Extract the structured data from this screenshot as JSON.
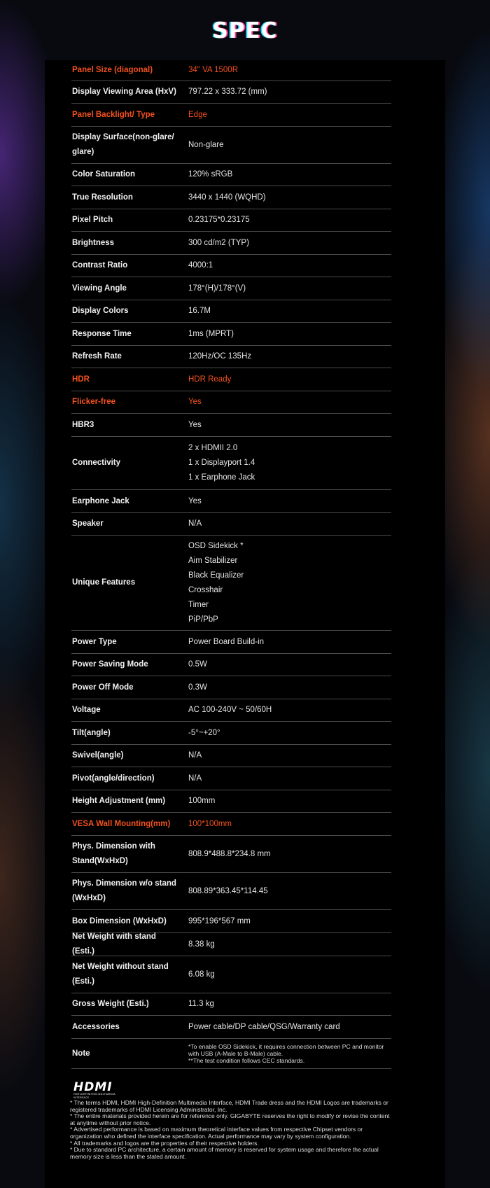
{
  "header": {
    "title": "SPEC"
  },
  "specs": [
    {
      "label": "Panel Size (diagonal)",
      "value": "34\" VA 1500R",
      "highlight": true
    },
    {
      "label": "Display Viewing Area (HxV)",
      "value": "797.22 x 333.72 (mm)"
    },
    {
      "label": "Panel Backlight/ Type",
      "value": "Edge",
      "highlight": true
    },
    {
      "label": "Display Surface(non-glare/ glare)",
      "value": "Non-glare"
    },
    {
      "label": "Color Saturation",
      "value": "120% sRGB"
    },
    {
      "label": "True Resolution",
      "value": "3440 x 1440 (WQHD)"
    },
    {
      "label": "Pixel Pitch",
      "value": "0.23175*0.23175"
    },
    {
      "label": "Brightness",
      "value": "300 cd/m2 (TYP)"
    },
    {
      "label": "Contrast Ratio",
      "value": "4000:1"
    },
    {
      "label": "Viewing Angle",
      "value": "178°(H)/178°(V)"
    },
    {
      "label": "Display Colors",
      "value": "16.7M"
    },
    {
      "label": "Response Time",
      "value": "1ms (MPRT)"
    },
    {
      "label": "Refresh Rate",
      "value": "120Hz/OC 135Hz"
    },
    {
      "label": "HDR",
      "value": "HDR Ready",
      "highlight": true
    },
    {
      "label": "Flicker-free",
      "value": "Yes",
      "highlight": true
    },
    {
      "label": "HBR3",
      "value": "Yes"
    },
    {
      "label": "Connectivity",
      "values": [
        "2 x HDMII 2.0",
        "1 x Displayport 1.4",
        "1 x Earphone Jack"
      ]
    },
    {
      "label": "Earphone Jack",
      "value": "Yes"
    },
    {
      "label": "Speaker",
      "value": "N/A"
    },
    {
      "label": "Unique Features",
      "values": [
        "OSD Sidekick *",
        "Aim Stabilizer",
        "Black Equalizer",
        "Crosshair",
        "Timer",
        "PiP/PbP"
      ]
    },
    {
      "label": "Power Type",
      "value": "Power Board Build-in"
    },
    {
      "label": "Power Saving Mode",
      "value": "0.5W"
    },
    {
      "label": "Power Off Mode",
      "value": "0.3W"
    },
    {
      "label": "Voltage",
      "value": "AC 100-240V ~ 50/60H"
    },
    {
      "label": "Tilt(angle)",
      "value": "-5°~+20°"
    },
    {
      "label": "Swivel(angle)",
      "value": "N/A"
    },
    {
      "label": "Pivot(angle/direction)",
      "value": "N/A"
    },
    {
      "label": "Height Adjustment (mm)",
      "value": "100mm"
    },
    {
      "label": "VESA Wall Mounting(mm)",
      "value": "100*100mm",
      "highlight": true
    },
    {
      "label": "Phys. Dimension with Stand(WxHxD)",
      "value": "808.9*488.8*234.8 mm"
    },
    {
      "label": "Phys. Dimension w/o stand (WxHxD)",
      "value": "808.89*363.45*114.45"
    },
    {
      "label": "Box Dimension (WxHxD)",
      "value": "995*196*567 mm"
    },
    {
      "label": "Net Weight with stand (Esti.)",
      "value": "8.38 kg"
    },
    {
      "label": "Net Weight without stand (Esti.)",
      "value": "6.08 kg"
    },
    {
      "label": "Gross Weight (Esti.)",
      "value": "11.3 kg"
    },
    {
      "label": "Accessories",
      "value": "Power cable/DP cable/QSG/Warranty card"
    },
    {
      "label": "Note",
      "notes": [
        "*To enable OSD Sidekick, it requires connection between PC and monitor with USB (A-Male to B-Male) cable.",
        "**The test condition follows CEC standards."
      ]
    }
  ],
  "hdmi_logo": {
    "word": "HDMI",
    "tagline": "HIGH-DEFINITION MULTIMEDIA INTERFACE"
  },
  "footnotes": [
    "* The terms HDMI, HDMI High-Definition Multimedia Interface, HDMI Trade dress and the HDMI Logos are trademarks or registered trademarks of HDMI Licensing Administrator, Inc.",
    "* The entire materials provided herein are for reference only. GIGABYTE reserves the right to modify or revise the content at anytime without prior notice.",
    "* Advertised performance is based on maximum theoretical interface values from respective Chipset vendors or organization who defined the interface specification. Actual performance may vary by system configuration.",
    "* All trademarks and logos are the properties of their respective holders.",
    "* Due to standard PC architecture, a certain amount of memory is reserved for system usage and therefore the actual memory size is less than the stated amount."
  ]
}
